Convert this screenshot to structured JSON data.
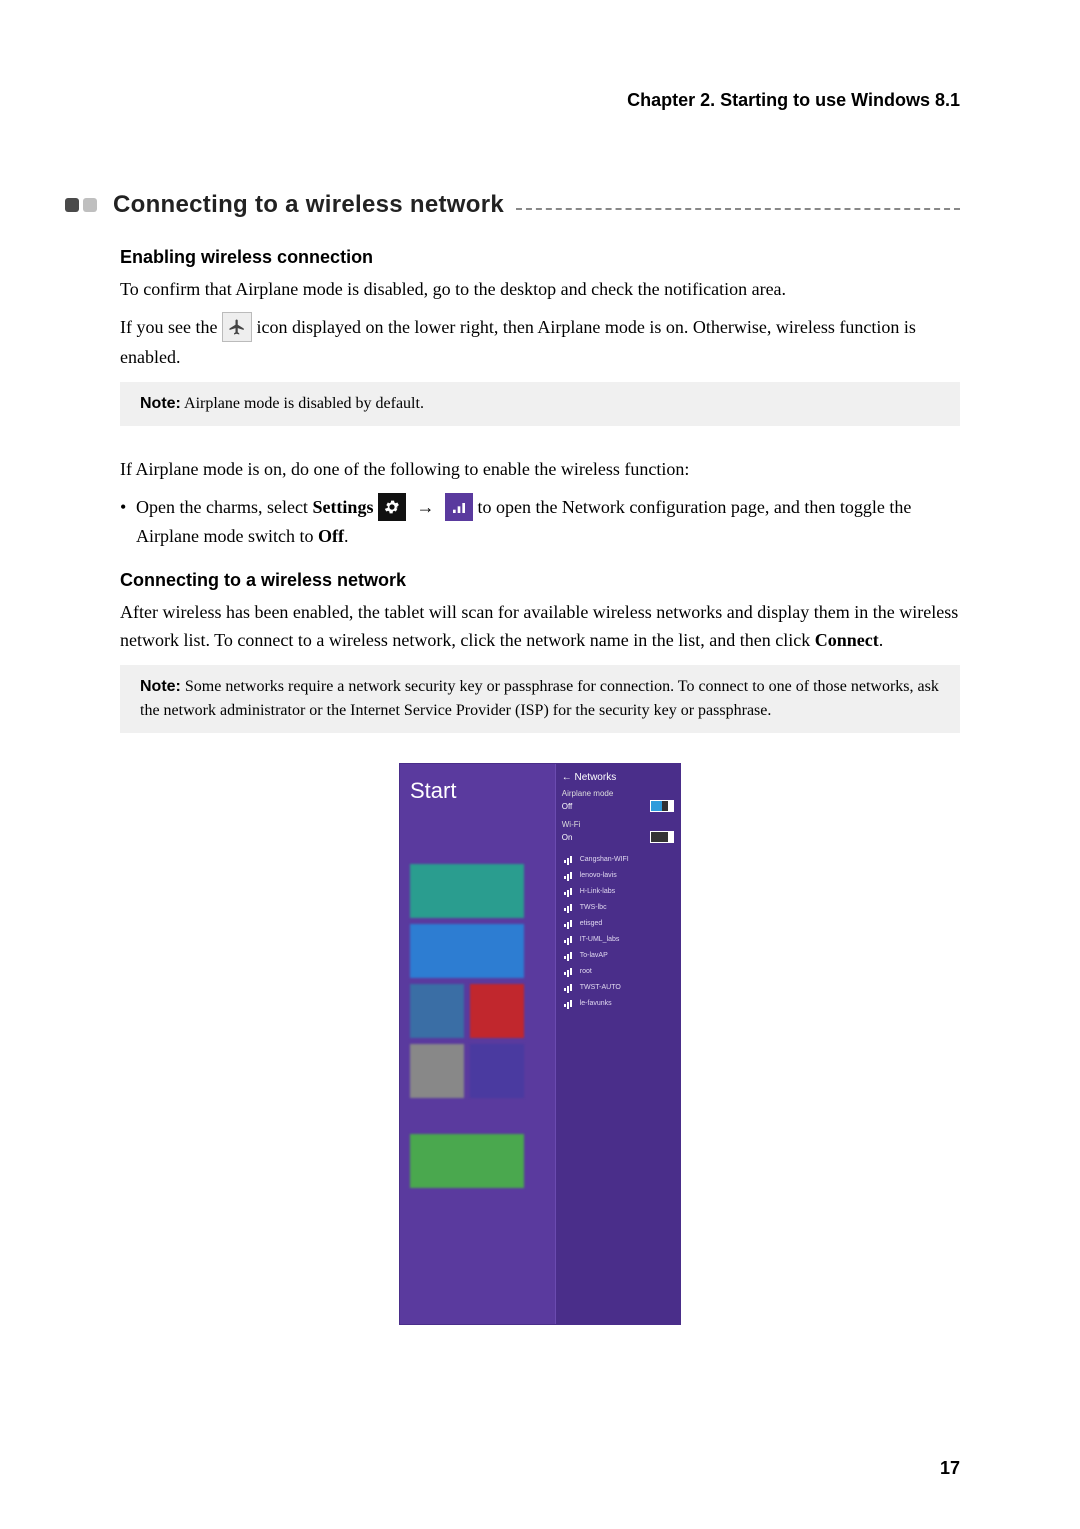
{
  "chapter_header": "Chapter 2. Starting to use Windows 8.1",
  "section_title": "Connecting to a wireless network",
  "sub1": {
    "heading": "Enabling wireless connection",
    "p1": "To confirm that Airplane mode is disabled, go to the desktop and check the notification area.",
    "p2a": "If you see the ",
    "p2b": " icon displayed on the lower right, then Airplane mode is on. Otherwise, wireless function is enabled.",
    "note_label": "Note:",
    "note_text": " Airplane mode is disabled by default.",
    "p3": "If Airplane mode is on, do one of the following to enable the wireless function:",
    "bullet_a": "Open the charms, select ",
    "bullet_settings": "Settings",
    "bullet_b": " to open the Network configuration page, and then toggle the Airplane mode switch to ",
    "bullet_off": "Off",
    "bullet_period": "."
  },
  "sub2": {
    "heading": "Connecting to a wireless network",
    "p1a": "After wireless has been enabled, the tablet will scan for available wireless networks and display them in the wireless network list. To connect to a wireless network, click the network name in the list, and then click ",
    "p1_connect": "Connect",
    "p1b": ".",
    "note_label": "Note:",
    "note_text": " Some networks require a network security key or passphrase for connection. To connect to one of those networks, ask the network administrator or the Internet Service Provider (ISP) for the security key or passphrase."
  },
  "figure": {
    "start_label": "Start",
    "networks_header": "Networks",
    "airplane_label": "Airplane mode",
    "airplane_state": "Off",
    "wifi_label": "Wi-Fi",
    "wifi_state": "On",
    "networks": [
      "Cangshan-WIFI",
      "lenovo-lavis",
      "H-Link-labs",
      "TWS-lbc",
      "etisged",
      "IT-UML_labs",
      "To-lavAP",
      "root",
      "TWST-AUTO",
      "le-favunks"
    ]
  },
  "page_number": "17"
}
